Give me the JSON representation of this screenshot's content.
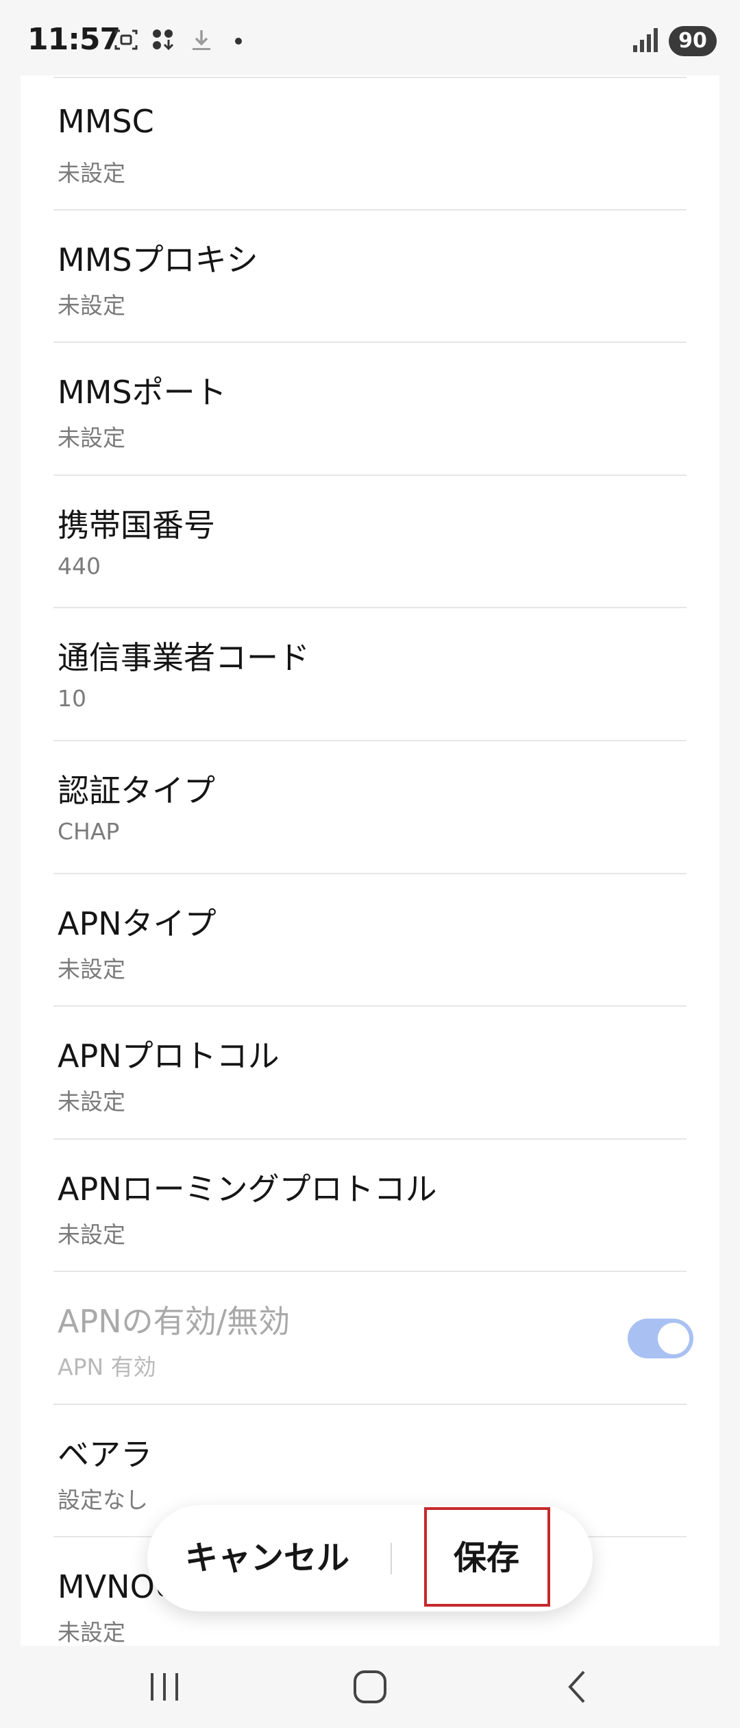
{
  "status_bar": {
    "time": "11:57",
    "battery": "90",
    "icons": [
      "screenshot-icon",
      "apps-download-icon",
      "download-icon",
      "dot-icon",
      "signal-icon"
    ]
  },
  "settings": [
    {
      "label": "MMSC",
      "value": "未設定",
      "disabled": false
    },
    {
      "label": "MMSプロキシ",
      "value": "未設定",
      "disabled": false
    },
    {
      "label": "MMSポート",
      "value": "未設定",
      "disabled": false
    },
    {
      "label": "携帯国番号",
      "value": "440",
      "disabled": false
    },
    {
      "label": "通信事業者コード",
      "value": "10",
      "disabled": false
    },
    {
      "label": "認証タイプ",
      "value": "CHAP",
      "disabled": false
    },
    {
      "label": "APNタイプ",
      "value": "未設定",
      "disabled": false
    },
    {
      "label": "APNプロトコル",
      "value": "未設定",
      "disabled": false
    },
    {
      "label": "APNローミングプロトコル",
      "value": "未設定",
      "disabled": false
    },
    {
      "label": "APNの有効/無効",
      "value": "APN 有効",
      "disabled": true,
      "toggle_on": true
    },
    {
      "label": "ベアラ",
      "value": "設定なし",
      "disabled": false
    },
    {
      "label": "MVNOの種類",
      "value": "未設定",
      "disabled": false
    }
  ],
  "actions": {
    "cancel": "キャンセル",
    "save": "保存"
  },
  "colors": {
    "toggle_track": "#a9c1f2",
    "highlight_box": "#c6282b"
  }
}
